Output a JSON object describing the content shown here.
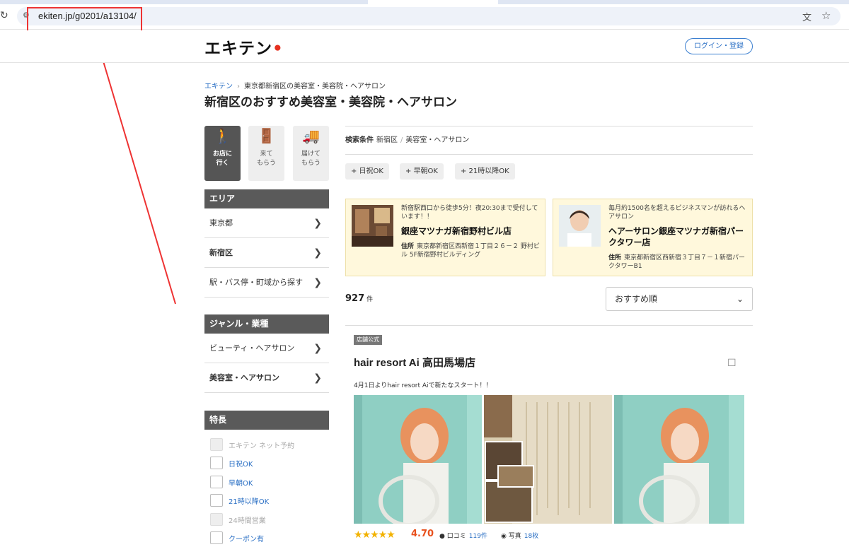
{
  "browser": {
    "url": "ekiten.jp/g0201/a13104/",
    "reload_icon": "reload-icon",
    "site_info_icon": "site-info-icon",
    "translate_icon": "translate-icon",
    "bookmark_icon": "star-icon"
  },
  "header": {
    "logo": "エキテン",
    "login": "ログイン・登録"
  },
  "breadcrumb": {
    "home": "エキテン",
    "current": "東京都新宿区の美容室・美容院・ヘアサロン"
  },
  "page_title": "新宿区のおすすめ美容室・美容院・ヘアサロン",
  "modes": [
    {
      "label_1": "お店に",
      "label_2": "行く",
      "icon": "walk-icon",
      "active": true
    },
    {
      "label_1": "来て",
      "label_2": "もらう",
      "icon": "door-icon",
      "active": false
    },
    {
      "label_1": "届けて",
      "label_2": "もらう",
      "icon": "delivery-icon",
      "active": false
    }
  ],
  "sidebar": {
    "area": {
      "heading": "エリア",
      "items": [
        "東京都",
        "新宿区",
        "駅・バス停・町域から探す"
      ]
    },
    "genre": {
      "heading": "ジャンル・業種",
      "items": [
        "ビューティ・ヘアサロン",
        "美容室・ヘアサロン"
      ]
    },
    "features": {
      "heading": "特長",
      "items": [
        {
          "label": "エキテン ネット予約",
          "enabled": false
        },
        {
          "label": "日祝OK",
          "enabled": true
        },
        {
          "label": "早朝OK",
          "enabled": true
        },
        {
          "label": "21時以降OK",
          "enabled": true
        },
        {
          "label": "24時間営業",
          "enabled": false
        },
        {
          "label": "クーポン有",
          "enabled": true
        }
      ]
    }
  },
  "conditions": {
    "label": "検索条件",
    "values": [
      "新宿区",
      "美容室・ヘアサロン"
    ]
  },
  "chips": [
    "+ 日祝OK",
    "+ 早朝OK",
    "+ 21時以降OK"
  ],
  "ads": [
    {
      "lead": "新宿駅西口から徒歩5分！夜20:30まで受付しています！！",
      "name": "銀座マツナガ新宿野村ビル店",
      "addr_label": "住所",
      "addr": "東京都新宿区西新宿１丁目２６－２ 野村ビル 5F新宿野村ビルディング"
    },
    {
      "lead": "毎月約1500名を超えるビジネスマンが訪れるヘアサロン",
      "name": "ヘアーサロン銀座マツナガ新宿パークタワー店",
      "addr_label": "住所",
      "addr": "東京都新宿区西新宿３丁目７－１新宿パークタワーB1"
    }
  ],
  "results": {
    "count": "927",
    "unit": "件",
    "sort": "おすすめ順"
  },
  "shop": {
    "badge": "店舗公式",
    "name": "hair resort Ai 高田馬場店",
    "catch": "4月1日よりhair resort Aiで新たなスタート！！",
    "stars": "★★★★★",
    "rating": 4.7,
    "rating_text": "4.70",
    "reviews_label": "口コミ",
    "reviews": "119件",
    "photos_label": "写真",
    "photos": "18枚"
  },
  "colors": {
    "accent_blue": "#2a6fc4",
    "logo_red": "#e6301f",
    "sidebar_heading": "#5a5a5a",
    "ad_bg": "#fff8dc",
    "rating": "#e8501c",
    "annotation_red": "#e33333"
  }
}
